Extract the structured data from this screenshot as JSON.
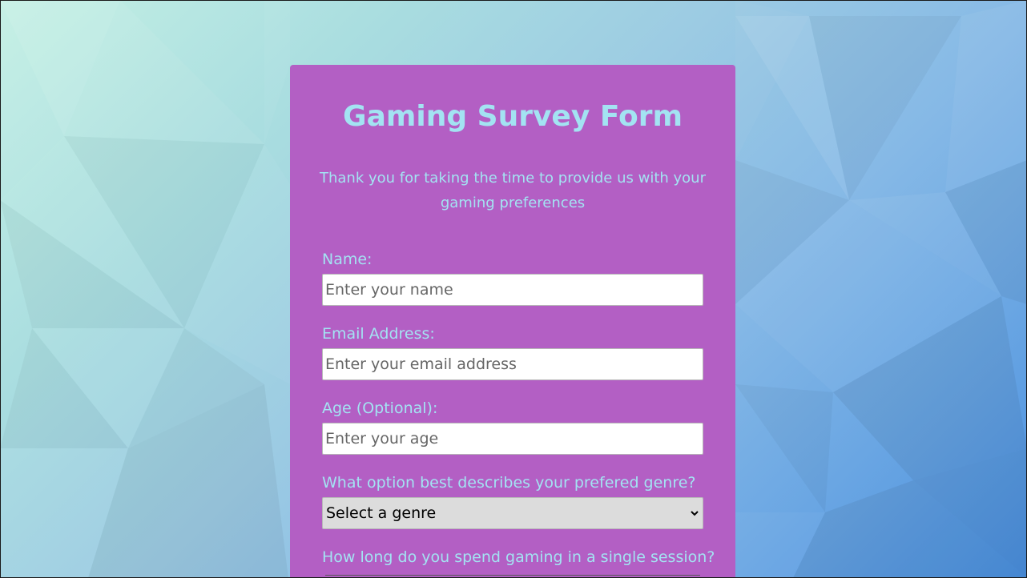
{
  "form": {
    "title": "Gaming Survey Form",
    "description": "Thank you for taking the time to provide us with your gaming preferences",
    "fields": {
      "name": {
        "label": "Name:",
        "placeholder": "Enter your name"
      },
      "email": {
        "label": "Email Address:",
        "placeholder": "Enter your email address"
      },
      "age": {
        "label": "Age (Optional):",
        "placeholder": "Enter your age"
      },
      "genre": {
        "label": "What option best describes your prefered genre?",
        "selected": "Select a genre"
      },
      "session": {
        "label": "How long do you spend gaming in a single session?"
      }
    }
  },
  "colors": {
    "card": "#b35fc4",
    "accent_text": "#a3e3f2",
    "select_bg": "#dcdcdc"
  }
}
